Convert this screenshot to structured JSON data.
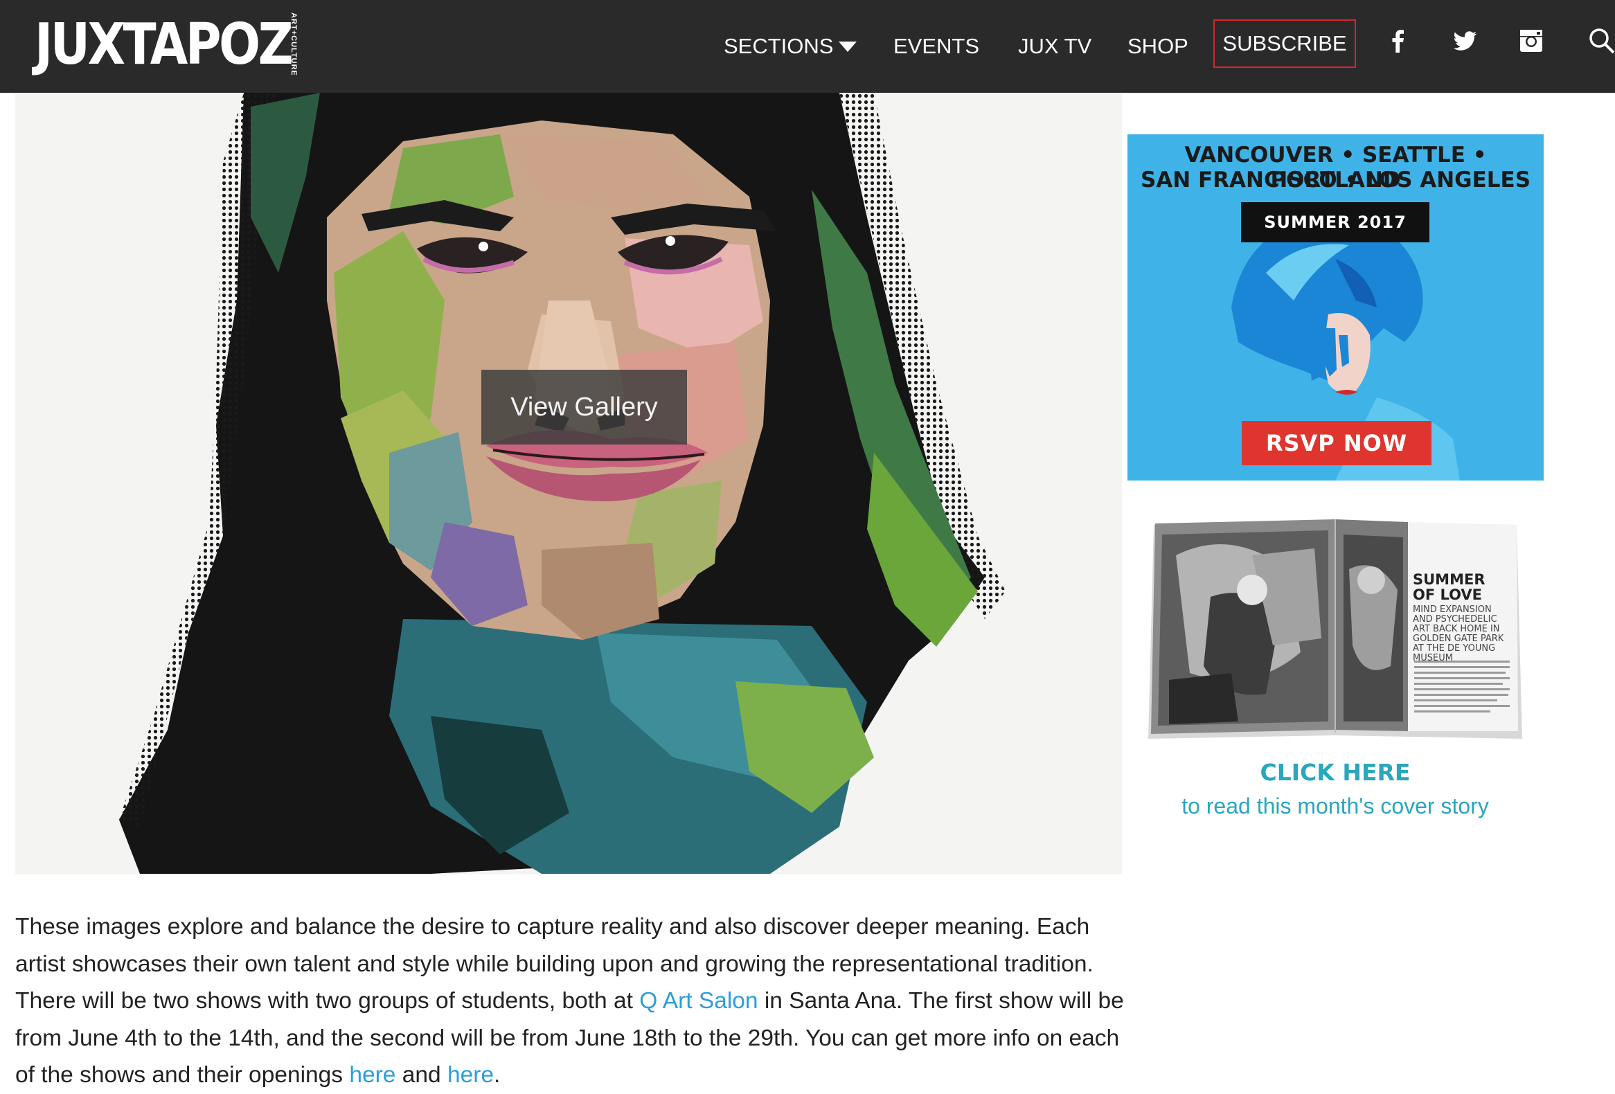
{
  "header": {
    "logo": "JUXTAPOZ",
    "logo_tagline": "ART+CULTURE",
    "nav": {
      "sections": "SECTIONS",
      "events": "EVENTS",
      "juxtv": "JUX TV",
      "shop": "SHOP",
      "subscribe": "SUBSCRIBE"
    },
    "social_icons": [
      "facebook-icon",
      "twitter-icon",
      "instagram-icon",
      "search-icon"
    ]
  },
  "hero": {
    "view_gallery": "View Gallery"
  },
  "ad": {
    "cities_line1": "VANCOUVER • SEATTLE • PORTLAND",
    "cities_line2": "SAN FRANCISCO • LOS ANGELES",
    "season": "SUMMER 2017",
    "cta": "RSVP NOW"
  },
  "promo": {
    "magazine_headline": "SUMMER OF LOVE",
    "magazine_subhead": "MIND EXPANSION AND PSYCHEDELIC ART BACK HOME IN GOLDEN GATE PARK AT THE DE YOUNG MUSEUM",
    "click_here": "CLICK HERE",
    "click_sub": "to read this month's cover story"
  },
  "article": {
    "p1": "These images explore and balance the desire to capture reality and also discover deeper meaning. Each artist showcases their own talent and style while building upon and growing the representational tradition. There will be two shows with two groups of students, both at ",
    "link1": "Q Art Salon",
    "p2": " in Santa Ana. The first show will be from June 4th to the 14th, and the second will be from June 18th to the 29th. You can get more info on each of the shows and their openings ",
    "link2": "here",
    "p3": " and ",
    "link3": "here",
    "p4": "."
  },
  "colors": {
    "nav_bg": "#2a2a2a",
    "subscribe_border": "#d6262d",
    "link_blue": "#2a9fd8",
    "promo_teal": "#2aa6bd",
    "ad_blue": "#3fb3e7",
    "ad_red": "#e0352f"
  }
}
